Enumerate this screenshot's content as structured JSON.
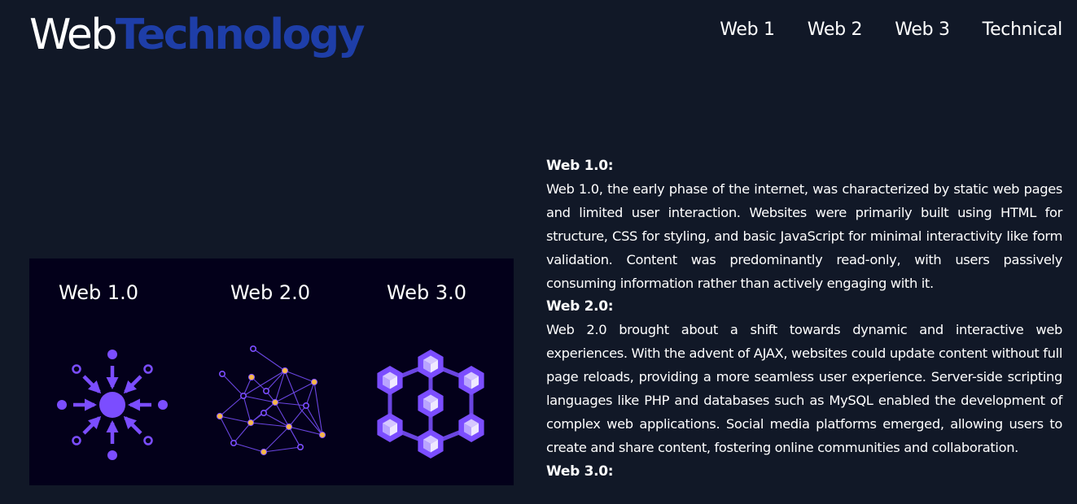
{
  "header": {
    "logo_part_1": "Web",
    "logo_part_2": "Technology",
    "nav": [
      {
        "label": "Web 1"
      },
      {
        "label": "Web 2"
      },
      {
        "label": "Web 3"
      },
      {
        "label": "Technical"
      }
    ]
  },
  "hero": {
    "labels": [
      "Web 1.0",
      "Web 2.0",
      "Web 3.0"
    ],
    "icons": [
      "hub-arrows-icon",
      "network-graph-icon",
      "blockchain-cubes-icon"
    ]
  },
  "sections": [
    {
      "title": "Web 1.0:",
      "text": "Web 1.0, the early phase of the internet, was characterized by static web pages and limited user interaction. Websites were primarily built using HTML for structure, CSS for styling, and basic JavaScript for minimal interactivity like form validation. Content was predominantly read-only, with users passively consuming information rather than actively engaging with it."
    },
    {
      "title": "Web 2.0:",
      "text": "Web 2.0 brought about a shift towards dynamic and interactive web experiences. With the advent of AJAX, websites could update content without full page reloads, providing a more seamless user experience. Server-side scripting languages like PHP and databases such as MySQL enabled the development of complex web applications. Social media platforms emerged, allowing users to create and share content, fostering online communities and collaboration."
    },
    {
      "title": "Web 3.0:",
      "text": ""
    }
  ],
  "colors": {
    "background": "#111827",
    "logo_accent": "#1e3ea8",
    "image_background": "#03001a",
    "icon_purple": "#7b4dff",
    "icon_gold": "#f5b84a"
  }
}
